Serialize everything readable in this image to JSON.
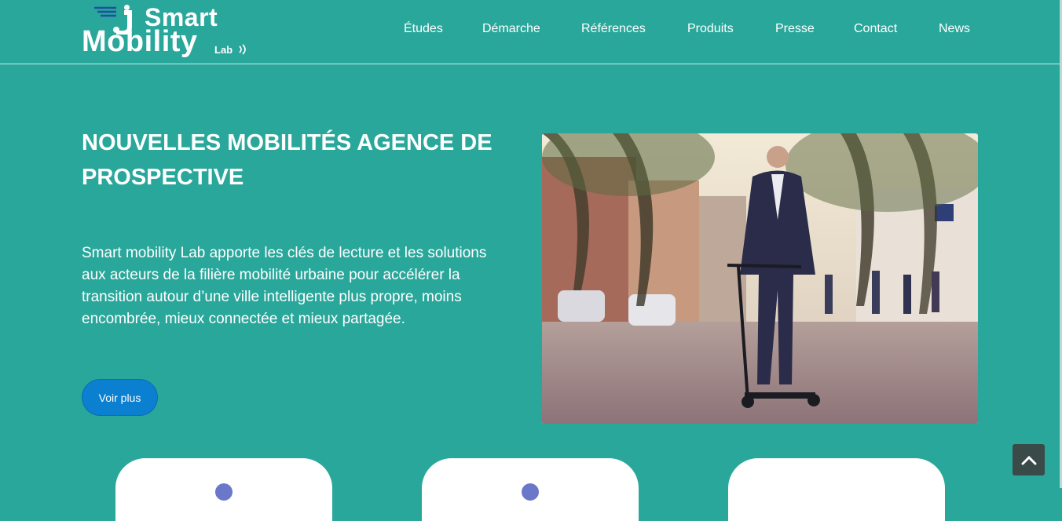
{
  "brand": {
    "logo_line1": "Smart",
    "logo_line2": "Mobility",
    "logo_line3": "Lab",
    "accent": "#2aa79b",
    "button_color": "#0b7fd0"
  },
  "nav": {
    "items": [
      {
        "label": "Études"
      },
      {
        "label": "Démarche"
      },
      {
        "label": "Références"
      },
      {
        "label": "Produits"
      },
      {
        "label": "Presse"
      },
      {
        "label": "Contact"
      },
      {
        "label": "News"
      }
    ]
  },
  "hero": {
    "title": "NOUVELLES MOBILITÉS AGENCE DE PROSPECTIVE",
    "text": "Smart mobility Lab apporte les clés de lecture et les solutions aux acteurs de la filière mobilité urbaine pour accélérer la transition autour d’une ville intelligente plus propre, moins encombrée, mieux connectée et mieux partagée.",
    "button_label": "Voir plus",
    "image_icon": "scooter-rider-photo"
  },
  "cards": [
    {
      "icon": "circle-icon"
    },
    {
      "icon": "circle-icon"
    },
    {
      "icon": "circle-icon"
    }
  ],
  "scroll_top_icon": "chevron-up-icon"
}
